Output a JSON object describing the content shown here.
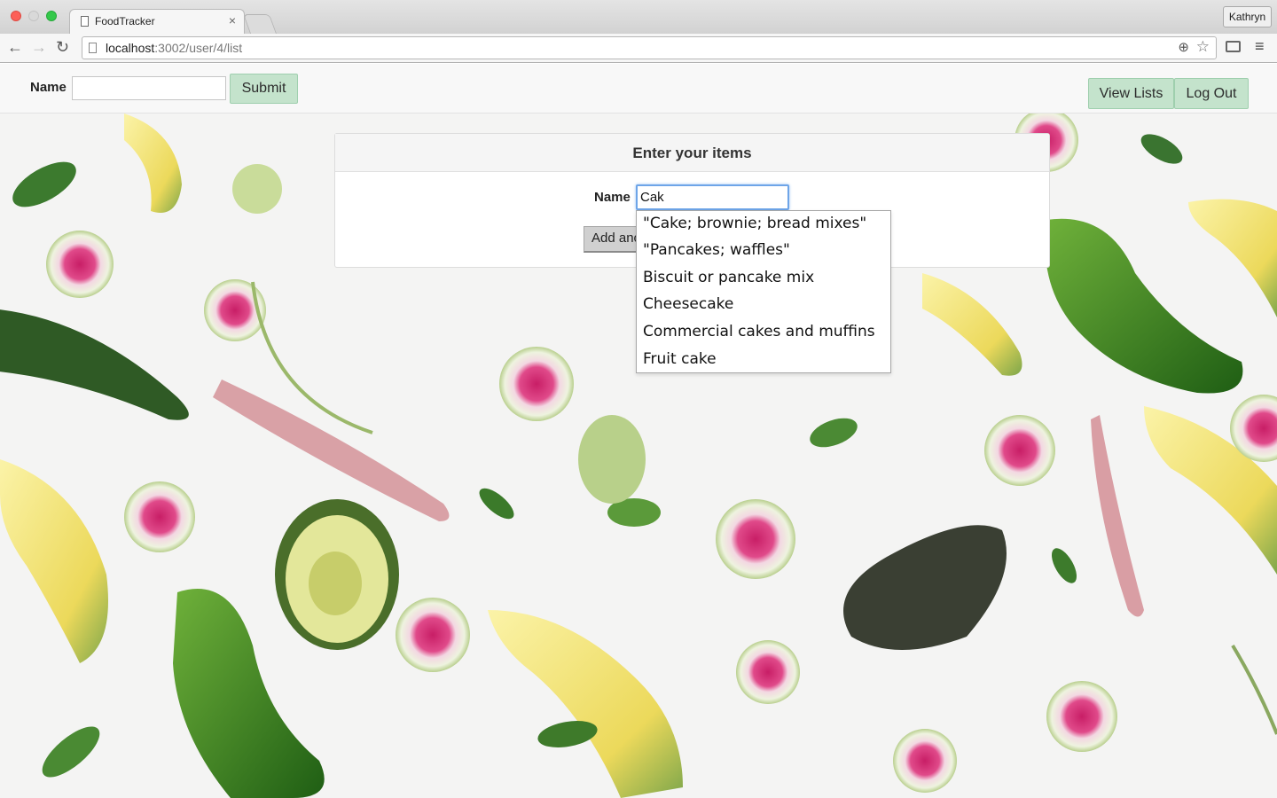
{
  "browser": {
    "tab_title": "FoodTracker",
    "tab_close": "×",
    "profile_name": "Kathryn",
    "url_host": "localhost",
    "url_rest": ":3002/user/4/list",
    "back_glyph": "←",
    "forward_glyph": "→",
    "reload_glyph": "↻",
    "zoom_glyph": "⊕",
    "star_glyph": "☆",
    "menu_glyph": "≡"
  },
  "topbar": {
    "name_label": "Name",
    "name_value": "",
    "submit_label": "Submit",
    "view_lists_label": "View Lists",
    "logout_label": "Log Out"
  },
  "panel": {
    "title": "Enter your items",
    "name_label": "Name",
    "name_value": "Cak",
    "add_button_label": "Add another"
  },
  "autocomplete": {
    "items": [
      "\"Cake; brownie; bread mixes\"",
      "\"Pancakes; waffles\"",
      "Biscuit or pancake mix",
      "Cheesecake",
      "Commercial cakes and muffins",
      "Fruit cake"
    ]
  },
  "colors": {
    "button_green": "#c4e3cc",
    "focus_blue": "#6ea5e8",
    "radish_pink": "#d9407a",
    "avocado_yellow": "#f1e27a",
    "pepper_green": "#3e8a2a"
  },
  "icons": [
    "page-icon",
    "close-icon",
    "back-arrow-icon",
    "forward-arrow-icon",
    "reload-icon",
    "zoom-icon",
    "star-icon",
    "cast-icon",
    "menu-icon"
  ]
}
